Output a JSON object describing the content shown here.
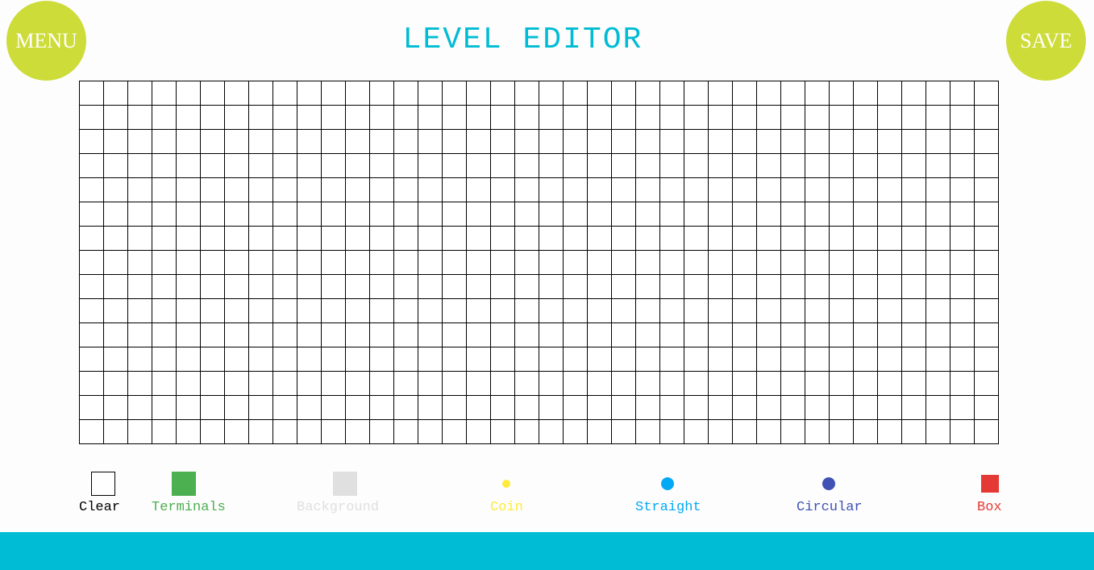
{
  "header": {
    "title": "LEVEL EDITOR",
    "menu_label": "MENU",
    "save_label": "SAVE",
    "button_color": "#cddc39",
    "title_color": "#00bcd4"
  },
  "grid": {
    "columns": 38,
    "rows": 15
  },
  "palette": [
    {
      "label": "Clear",
      "color": "#ffffff",
      "label_color": "#000000",
      "icon": "clear-square-icon"
    },
    {
      "label": "Terminals",
      "color": "#4caf50",
      "label_color": "#4caf50",
      "icon": "terminal-square-icon"
    },
    {
      "label": "Background",
      "color": "#e0e0e0",
      "label_color": "#e0e0e0",
      "icon": "background-square-icon"
    },
    {
      "label": "Coin",
      "color": "#ffeb3b",
      "label_color": "#ffeb3b",
      "icon": "coin-dot-icon"
    },
    {
      "label": "Straight",
      "color": "#03a9f4",
      "label_color": "#03a9f4",
      "icon": "straight-dot-icon"
    },
    {
      "label": "Circular",
      "color": "#3f51b5",
      "label_color": "#3f51b5",
      "icon": "circular-dot-icon"
    },
    {
      "label": "Box",
      "color": "#e53935",
      "label_color": "#e53935",
      "icon": "box-square-icon"
    }
  ],
  "footer": {
    "bar_color": "#00bcd4"
  }
}
